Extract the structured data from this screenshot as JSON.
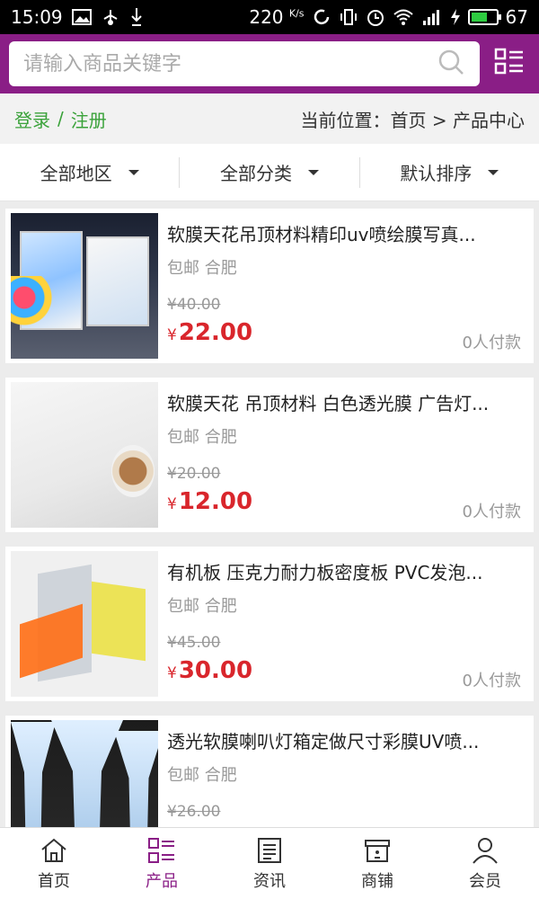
{
  "status_bar": {
    "time": "15:09",
    "speed": "220",
    "speed_unit": "K/s",
    "battery": "67",
    "battery_level": 0.67,
    "icons": [
      "image-icon",
      "usb-icon",
      "download-icon",
      "sync-icon",
      "vibrate-icon",
      "alarm-icon",
      "wifi-icon",
      "signal-icon",
      "charging-icon",
      "battery-icon"
    ]
  },
  "header": {
    "search_placeholder": "请输入商品关键字",
    "accent_color": "#8a1e86"
  },
  "breadcrumb": {
    "login": "登录",
    "separator": "/",
    "register": "注册",
    "location": "当前位置：首页 > 产品中心"
  },
  "filters": [
    {
      "label": "全部地区"
    },
    {
      "label": "全部分类"
    },
    {
      "label": "默认排序"
    }
  ],
  "products": [
    {
      "title": "软膜天花吊顶材料精印uv喷绘膜写真...",
      "tags": "包邮 合肥",
      "orig_price": "¥40.00",
      "currency": "¥",
      "price": "22.00",
      "paid": "0人付款"
    },
    {
      "title": "软膜天花 吊顶材料 白色透光膜 广告灯...",
      "tags": "包邮 合肥",
      "orig_price": "¥20.00",
      "currency": "¥",
      "price": "12.00",
      "paid": "0人付款"
    },
    {
      "title": "有机板 压克力耐力板密度板 PVC发泡...",
      "tags": "包邮 合肥",
      "orig_price": "¥45.00",
      "currency": "¥",
      "price": "30.00",
      "paid": "0人付款"
    },
    {
      "title": "透光软膜喇叭灯箱定做尺寸彩膜UV喷...",
      "tags": "包邮 合肥",
      "orig_price": "¥26.00",
      "currency": "¥",
      "price": "",
      "paid": ""
    }
  ],
  "bottom_nav": [
    {
      "label": "首页",
      "icon": "home-icon"
    },
    {
      "label": "产品",
      "icon": "product-grid-icon",
      "active": true
    },
    {
      "label": "资讯",
      "icon": "news-icon"
    },
    {
      "label": "商铺",
      "icon": "shop-icon"
    },
    {
      "label": "会员",
      "icon": "member-icon"
    }
  ]
}
